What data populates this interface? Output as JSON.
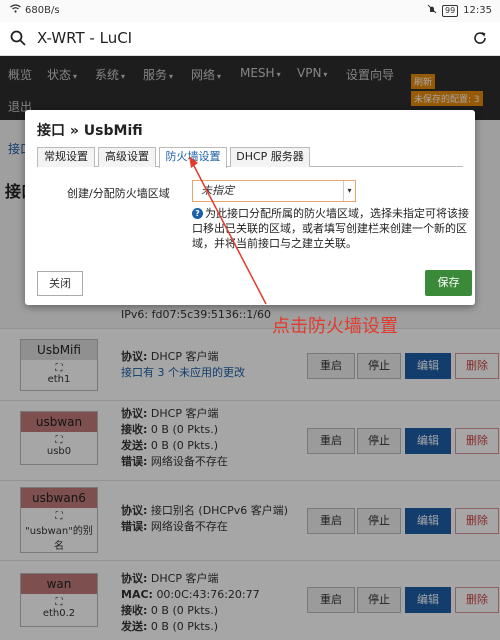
{
  "status_bar": {
    "speed": "680B/s",
    "battery": "99",
    "time": "12:35"
  },
  "browser": {
    "title": "X-WRT - LuCI"
  },
  "nav": {
    "items": [
      "概览",
      "状态",
      "系统",
      "服务",
      "网络",
      "MESH",
      "VPN",
      "设置向导"
    ],
    "logout": "退出",
    "refresh_badge": "刷新",
    "unsaved_badge": "未保存的配置: 3"
  },
  "page": {
    "breadcrumb": "接口",
    "heading": "接口",
    "ipv6_line": "IPv6: fd07:5c39:5136::1/60"
  },
  "interfaces": [
    {
      "name": "UsbMifi",
      "device": "eth1",
      "lines": [
        {
          "label": "协议:",
          "value": "DHCP 客户端"
        }
      ],
      "note": "接口有 3 个未应用的更改"
    },
    {
      "name": "usbwan",
      "device": "usb0",
      "lines": [
        {
          "label": "协议:",
          "value": "DHCP 客户端"
        },
        {
          "label": "接收:",
          "value": "0 B (0 Pkts.)"
        },
        {
          "label": "发送:",
          "value": "0 B (0 Pkts.)"
        },
        {
          "label": "错误:",
          "value": "网络设备不存在"
        }
      ]
    },
    {
      "name": "usbwan6",
      "device": "\"usbwan\"的别名",
      "lines": [
        {
          "label": "协议:",
          "value": "接口别名 (DHCPv6 客户端)"
        },
        {
          "label": "错误:",
          "value": "网络设备不存在"
        }
      ]
    },
    {
      "name": "wan",
      "device": "eth0.2",
      "lines": [
        {
          "label": "协议:",
          "value": "DHCP 客户端"
        },
        {
          "label": "MAC:",
          "value": "00:0C:43:76:20:77"
        },
        {
          "label": "接收:",
          "value": "0 B (0 Pkts.)"
        },
        {
          "label": "发送:",
          "value": "0 B (0 Pkts.)"
        }
      ]
    }
  ],
  "row_buttons": {
    "restart": "重启",
    "stop": "停止",
    "edit": "编辑",
    "delete": "删除"
  },
  "modal": {
    "title": "接口 » UsbMifi",
    "tabs": [
      "常规设置",
      "高级设置",
      "防火墙设置",
      "DHCP 服务器"
    ],
    "active_tab": "防火墙设置",
    "zone_label": "创建/分配防火墙区域",
    "zone_value": "未指定",
    "help_text": "为此接口分配所属的防火墙区域，选择未指定可将该接口移出已关联的区域，或者填写创建栏来创建一个新的区域，并将当前接口与之建立关联。",
    "close": "关闭",
    "save": "保存"
  },
  "annotation": "点击防火墙设置",
  "colors": {
    "accent": "#1c5fa8",
    "save": "#3a8a3a",
    "annotation": "#e23b2e"
  }
}
